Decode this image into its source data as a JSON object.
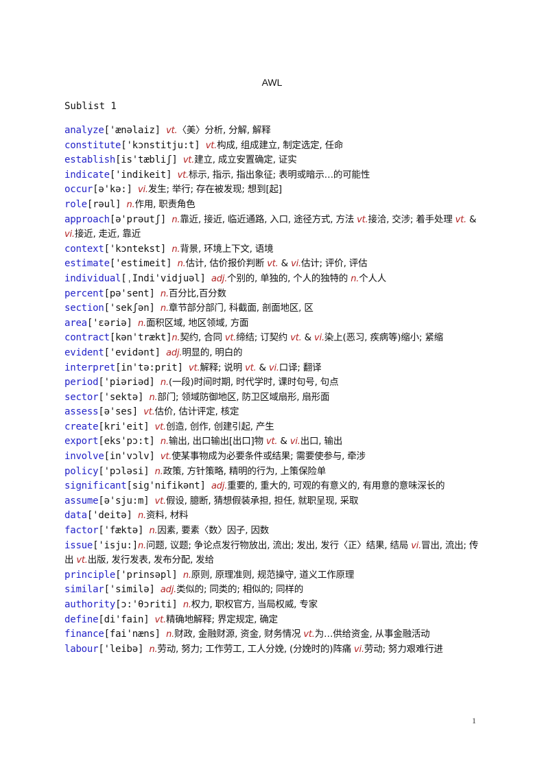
{
  "document": {
    "title": "AWL",
    "sublist": "Sublist 1",
    "page_number": "1"
  },
  "colors": {
    "headword": "#2323c8",
    "part_of_speech": "#b22222",
    "text": "#111111"
  },
  "entries": [
    {
      "word": "analyze",
      "phon": "['ænəlaiz] ",
      "parts": [
        {
          "pos": "vt.",
          "def": "〈美〉分析, 分解, 解释"
        }
      ]
    },
    {
      "word": "constitute",
      "phon": "['kɔnstitju:t] ",
      "parts": [
        {
          "pos": "vt.",
          "def": "构成, 组成建立, 制定选定, 任命"
        }
      ]
    },
    {
      "word": "establish",
      "phon": "[is'tæbliʃ] ",
      "parts": [
        {
          "pos": "vt.",
          "def": "建立, 成立安置确定, 证实"
        }
      ]
    },
    {
      "word": "indicate",
      "phon": "['indikeit] ",
      "parts": [
        {
          "pos": "vt.",
          "def": "标示, 指示, 指出象征; 表明或暗示…的可能性"
        }
      ]
    },
    {
      "word": "occur",
      "phon": "[ə'kə:] ",
      "parts": [
        {
          "pos": "vi.",
          "def": "发生; 举行; 存在被发现; 想到[起]"
        }
      ]
    },
    {
      "word": "role",
      "phon": "[rəul] ",
      "parts": [
        {
          "pos": "n.",
          "def": "作用, 职责角色"
        }
      ]
    },
    {
      "word": "approach",
      "phon": "[ə'prəutʃ] ",
      "parts": [
        {
          "pos": "n.",
          "def": "靠近, 接近, 临近通路, 入口, 途径方式, 方法 "
        },
        {
          "pos": "vt.",
          "def": "接洽, 交涉; 着手处理 "
        },
        {
          "pos": "vt.",
          "def": " & "
        },
        {
          "pos": "vi.",
          "def": "接近, 走近, 靠近"
        }
      ]
    },
    {
      "word": "context",
      "phon": "['kɔntekst] ",
      "parts": [
        {
          "pos": "n.",
          "def": "背景, 环境上下文, 语境"
        }
      ]
    },
    {
      "word": "estimate",
      "phon": "['estimeit] ",
      "parts": [
        {
          "pos": "n.",
          "def": "估计, 估价报价判断 "
        },
        {
          "pos": "vt.",
          "def": " & "
        },
        {
          "pos": "vi.",
          "def": "估计; 评价, 评估"
        }
      ]
    },
    {
      "word": "individual",
      "phon": "[ˌIndi'vidjuəl] ",
      "parts": [
        {
          "pos": "adj.",
          "def": "个别的, 单独的, 个人的独特的 "
        },
        {
          "pos": "n.",
          "def": "个人人"
        }
      ]
    },
    {
      "word": "percent",
      "phon": "[pə'sent] ",
      "parts": [
        {
          "pos": "n.",
          "def": "百分比,百分数"
        }
      ]
    },
    {
      "word": "section",
      "phon": "['sekʃən] ",
      "parts": [
        {
          "pos": "n.",
          "def": "章节部分部门, 科截面, 剖面地区, 区"
        }
      ]
    },
    {
      "word": "area",
      "phon": "['εəriə] ",
      "parts": [
        {
          "pos": "n.",
          "def": "面积区域, 地区领域, 方面"
        }
      ]
    },
    {
      "word": "contract",
      "phon": "[kən'trækt]",
      "parts": [
        {
          "pos": "n.",
          "def": "契约, 合同 "
        },
        {
          "pos": "vt.",
          "def": "缔结; 订契约 "
        },
        {
          "pos": "vt.",
          "def": " & "
        },
        {
          "pos": "vi.",
          "def": "染上(恶习, 疾病等)缩小; 紧缩"
        }
      ]
    },
    {
      "word": "evident",
      "phon": "['evidənt] ",
      "parts": [
        {
          "pos": "adj.",
          "def": "明显的, 明白的"
        }
      ]
    },
    {
      "word": "interpret",
      "phon": "[in'tə:prit] ",
      "parts": [
        {
          "pos": "vt.",
          "def": "解释; 说明 "
        },
        {
          "pos": "vt.",
          "def": " & "
        },
        {
          "pos": "vi.",
          "def": "口译; 翻译"
        }
      ]
    },
    {
      "word": "period",
      "phon": "['piəriəd] ",
      "parts": [
        {
          "pos": "n.",
          "def": "(一段)时间时期, 时代学时, 课时句号, 句点"
        }
      ]
    },
    {
      "word": "sector",
      "phon": "['sektə] ",
      "parts": [
        {
          "pos": "n.",
          "def": "部门; 领域防御地区, 防卫区域扇形, 扇形面"
        }
      ]
    },
    {
      "word": "assess",
      "phon": "[ə'ses] ",
      "parts": [
        {
          "pos": "vt.",
          "def": "估价, 估计评定, 核定"
        }
      ]
    },
    {
      "word": "create",
      "phon": "[kri'eit] ",
      "parts": [
        {
          "pos": "vt.",
          "def": "创造, 创作, 创建引起, 产生"
        }
      ]
    },
    {
      "word": "export",
      "phon": "[eks'pɔ:t] ",
      "parts": [
        {
          "pos": "n.",
          "def": "输出, 出口输出[出口]物 "
        },
        {
          "pos": "vt.",
          "def": " & "
        },
        {
          "pos": "vi.",
          "def": "出口, 输出"
        }
      ]
    },
    {
      "word": "involve",
      "phon": "[in'vɔlv] ",
      "parts": [
        {
          "pos": "vt.",
          "def": "使某事物成为必要条件或结果; 需要使参与, 牵涉"
        }
      ]
    },
    {
      "word": "policy",
      "phon": "['pɔləsi] ",
      "parts": [
        {
          "pos": "n.",
          "def": "政策, 方针策略, 精明的行为, 上策保险单"
        }
      ]
    },
    {
      "word": "significant",
      "phon": "[sig'nifikənt] ",
      "parts": [
        {
          "pos": "adj.",
          "def": "重要的, 重大的, 可观的有意义的, 有用意的意味深长的"
        }
      ]
    },
    {
      "word": "assume",
      "phon": "[ə'sju:m] ",
      "parts": [
        {
          "pos": "vt.",
          "def": "假设, 臆断, 猜想假装承担, 担任, 就职呈现, 采取"
        }
      ]
    },
    {
      "word": "data",
      "phon": "['deitə] ",
      "parts": [
        {
          "pos": "n.",
          "def": "资料, 材料"
        }
      ]
    },
    {
      "word": "factor",
      "phon": "['fæktə] ",
      "parts": [
        {
          "pos": "n.",
          "def": "因素, 要素〈数〉因子, 因数"
        }
      ]
    },
    {
      "word": "issue",
      "phon": "['isju:]",
      "parts": [
        {
          "pos": "n.",
          "def": "问题, 议题; 争论点发行物放出, 流出; 发出, 发行〈正〉结果, 结局 "
        },
        {
          "pos": "vi.",
          "def": "冒出, 流出; 传出 "
        },
        {
          "pos": "vt.",
          "def": "出版, 发行发表, 发布分配, 发给"
        }
      ]
    },
    {
      "word": "principle",
      "phon": "['prinsəpl] ",
      "parts": [
        {
          "pos": "n.",
          "def": "原则, 原理准则, 规范操守, 道义工作原理"
        }
      ]
    },
    {
      "word": "similar",
      "phon": "['similə] ",
      "parts": [
        {
          "pos": "adj.",
          "def": "类似的; 同类的; 相似的; 同样的"
        }
      ]
    },
    {
      "word": "authority",
      "phon": "[ɔ:'θɔriti] ",
      "parts": [
        {
          "pos": "n.",
          "def": "权力, 职权官方, 当局权威, 专家"
        }
      ]
    },
    {
      "word": "define",
      "phon": "[di'fain] ",
      "parts": [
        {
          "pos": "vt.",
          "def": "精确地解释; 界定规定, 确定"
        }
      ]
    },
    {
      "word": "finance",
      "phon": "[fai'næns] ",
      "parts": [
        {
          "pos": "n.",
          "def": "财政, 金融财源, 资金, 财务情况 "
        },
        {
          "pos": "vt.",
          "def": "为…供给资金, 从事金融活动"
        }
      ]
    },
    {
      "word": "labour",
      "phon": "['leibə] ",
      "parts": [
        {
          "pos": "n.",
          "def": "劳动, 努力; 工作劳工, 工人分娩, (分娩时的)阵痛 "
        },
        {
          "pos": "vi.",
          "def": "劳动; 努力艰难行进"
        }
      ]
    }
  ]
}
